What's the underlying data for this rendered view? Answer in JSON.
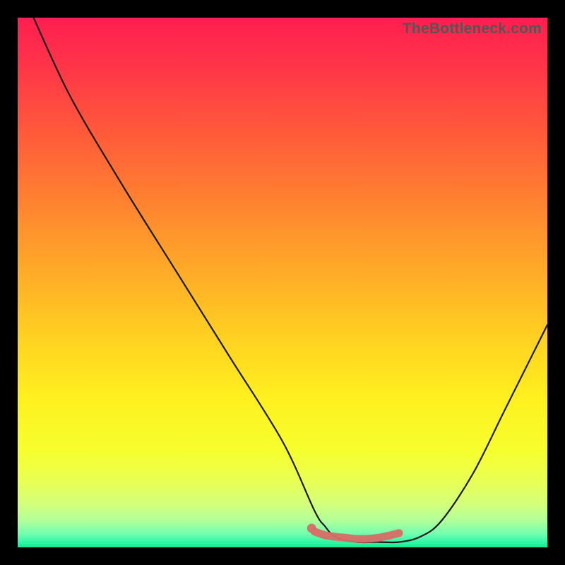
{
  "watermark": "TheBottleneck.com",
  "colors": {
    "background": "#000000",
    "curve": "#1a1a1a",
    "marker": "#d96b66",
    "gradient_stops": [
      {
        "offset": 0.0,
        "color": "#ff1e50"
      },
      {
        "offset": 0.1,
        "color": "#ff3747"
      },
      {
        "offset": 0.22,
        "color": "#ff5a3a"
      },
      {
        "offset": 0.35,
        "color": "#ff8330"
      },
      {
        "offset": 0.48,
        "color": "#ffab28"
      },
      {
        "offset": 0.6,
        "color": "#ffd021"
      },
      {
        "offset": 0.72,
        "color": "#fff01f"
      },
      {
        "offset": 0.82,
        "color": "#f6ff2e"
      },
      {
        "offset": 0.88,
        "color": "#e7ff58"
      },
      {
        "offset": 0.92,
        "color": "#d2ff7e"
      },
      {
        "offset": 0.95,
        "color": "#b0ff9a"
      },
      {
        "offset": 0.975,
        "color": "#70ffb0"
      },
      {
        "offset": 0.99,
        "color": "#30f7a8"
      },
      {
        "offset": 1.0,
        "color": "#17e98d"
      }
    ]
  },
  "chart_data": {
    "type": "line",
    "title": "",
    "xlabel": "",
    "ylabel": "",
    "xlim": [
      0,
      100
    ],
    "ylim": [
      0,
      100
    ],
    "series": [
      {
        "name": "bottleneck-curve",
        "x": [
          3,
          10,
          20,
          30,
          40,
          50,
          56,
          58,
          60,
          64,
          68,
          72,
          76,
          80,
          86,
          92,
          100
        ],
        "y": [
          100,
          85,
          68,
          52,
          36,
          20,
          7,
          4,
          2,
          1,
          1,
          1,
          2,
          5,
          14,
          26,
          42
        ]
      }
    ],
    "markers": [
      {
        "name": "highlight-segment",
        "x": [
          56,
          58,
          60,
          62,
          64,
          66,
          68,
          70,
          72
        ],
        "y": [
          3.0,
          2.3,
          2.0,
          1.8,
          1.6,
          1.6,
          1.8,
          2.2,
          2.7
        ]
      },
      {
        "name": "highlight-dot",
        "x": [
          55.5
        ],
        "y": [
          3.6
        ]
      }
    ]
  }
}
